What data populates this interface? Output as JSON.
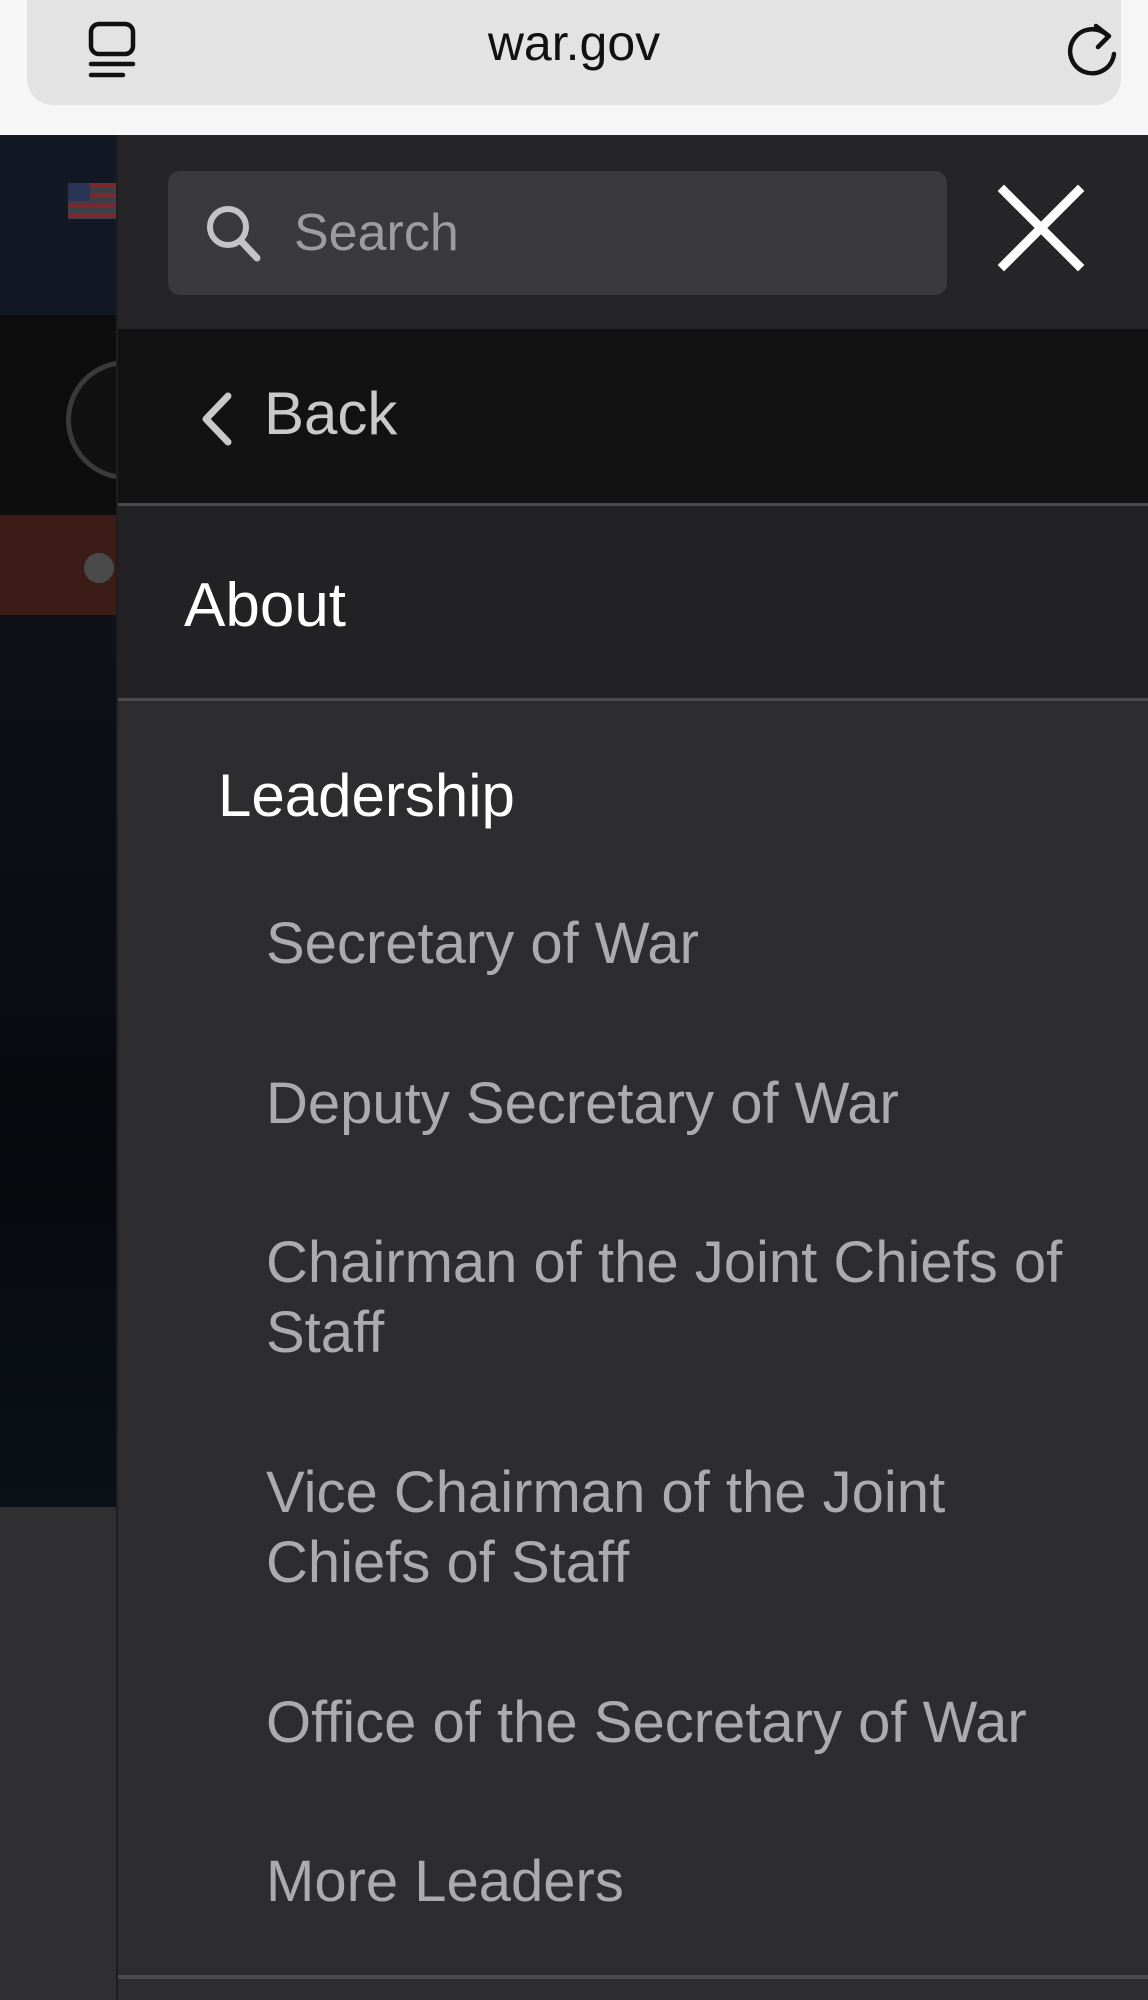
{
  "browser": {
    "url": "war.gov",
    "icons": [
      "reader-mode-icon",
      "reload-icon"
    ]
  },
  "menu": {
    "search": {
      "placeholder": "Search",
      "value": ""
    },
    "close_icon": "close-icon",
    "back_label": "Back",
    "current_section": "About",
    "group": {
      "heading": "Leadership",
      "items": [
        {
          "label": "Secretary of War"
        },
        {
          "label": "Deputy Secretary of War"
        },
        {
          "label": "Chairman of the Joint Chiefs of Staff"
        },
        {
          "label": "Vice Chairman of the Joint Chiefs of Staff"
        },
        {
          "label": "Office of the Secretary of War"
        },
        {
          "label": "More Leaders"
        }
      ]
    }
  },
  "colors": {
    "panel_bg": "#2d2d2f",
    "back_row_bg": "#121212",
    "about_row_bg": "#222224",
    "link_text": "#ababad",
    "heading_text": "#ffffff"
  }
}
